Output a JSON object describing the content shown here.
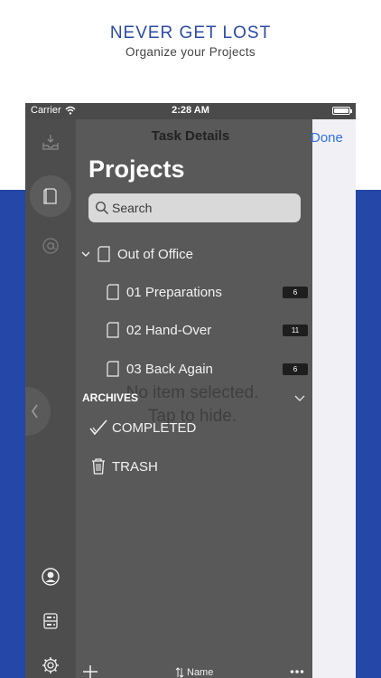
{
  "promo": {
    "title": "NEVER GET LOST",
    "subtitle": "Organize your Projects"
  },
  "status_bar": {
    "carrier": "Carrier",
    "time": "2:28 AM"
  },
  "nav": {
    "title": "Task Details",
    "done_label": "Done"
  },
  "projects": {
    "heading": "Projects",
    "search_placeholder": "Search",
    "folder": {
      "label": "Out of Office",
      "items": [
        {
          "label": "01 Preparations",
          "count": "6"
        },
        {
          "label": "02 Hand-Over",
          "count": "11"
        },
        {
          "label": "03 Back Again",
          "count": "6"
        }
      ]
    }
  },
  "detail_placeholder": {
    "line1": "No item selected.",
    "line2": "Tap to hide."
  },
  "archives": {
    "label": "ARCHIVES",
    "completed": "COMPLETED",
    "trash": "TRASH"
  },
  "bottom_bar": {
    "sort_label": "Name"
  },
  "colors": {
    "brand_blue": "#2447a8",
    "link_blue": "#2f6fe6",
    "panel_gray": "#595959"
  }
}
